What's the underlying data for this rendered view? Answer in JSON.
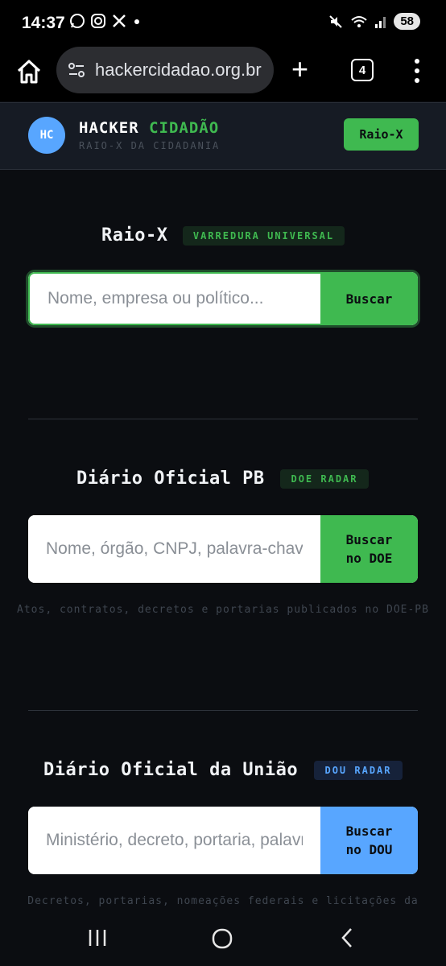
{
  "status": {
    "time": "14:37",
    "battery": "58"
  },
  "browser": {
    "url": "hackercidadao.org.br",
    "tab_count": "4"
  },
  "header": {
    "avatar": "HC",
    "brand_part1": "HACKER",
    "brand_part2": "CIDADÃO",
    "tagline": "RAIO-X DA CIDADANIA",
    "button_label": "Raio-X"
  },
  "raio_x": {
    "title": "Raio-X",
    "badge": "VARREDURA UNIVERSAL",
    "placeholder": "Nome, empresa ou político...",
    "button": "Buscar"
  },
  "doe": {
    "title": "Diário Oficial PB",
    "badge": "DOE RADAR",
    "placeholder": "Nome, órgão, CNPJ, palavra-chave...",
    "button": "Buscar\nno DOE",
    "caption": "Atos, contratos, decretos e portarias publicados no DOE-PB"
  },
  "dou": {
    "title": "Diário Oficial da União",
    "badge": "DOU RADAR",
    "placeholder": "Ministério, decreto, portaria, palavra-chave...",
    "button": "Buscar\nno DOU",
    "caption": "Decretos, portarias, nomeações federais e licitações da"
  },
  "colors": {
    "accent_green": "#3fb950",
    "accent_blue": "#58a6ff",
    "background": "#0b0d11"
  }
}
